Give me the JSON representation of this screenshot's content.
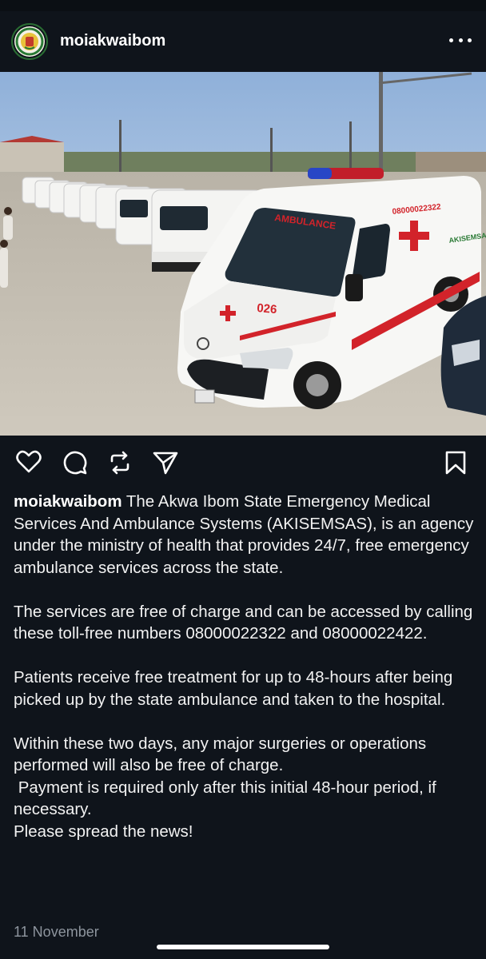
{
  "post": {
    "username": "moiakwaibom",
    "more_icon": "more-horizontal-icon",
    "image_alt": "Fleet of white ambulances parked in a row",
    "ambulance_label": "AMBULANCE",
    "ambulance_number": "026",
    "ambulance_phone": "08000022322",
    "ambulance_badge": "AKISEMSAS"
  },
  "actions": {
    "like_icon": "heart-icon",
    "comment_icon": "comment-icon",
    "repost_icon": "repost-icon",
    "share_icon": "send-icon",
    "save_icon": "bookmark-icon"
  },
  "caption": {
    "username": "moiakwaibom",
    "p1": " The Akwa Ibom State Emergency Medical Services And Ambulance Systems (AKISEMSAS), is an agency under the ministry of health that provides 24/7, free emergency ambulance services across the state.",
    "p2": "The services are free of charge and can be accessed by calling these toll-free numbers 08000022322 and 08000022422.",
    "p3": "Patients receive free treatment for up to 48-hours after being picked up by the state ambulance and taken to the hospital.",
    "p4_line1": "Within these two days, any major surgeries or operations performed will also be free of charge.",
    "p4_line2": " Payment is required only after this initial 48-hour period, if necessary.",
    "p4_line3": "Please spread the news!"
  },
  "date": "11 November",
  "colors": {
    "background": "#0f141b",
    "text": "#f2f2f2",
    "muted": "#8e959e",
    "ambulance_red": "#d2232a"
  }
}
